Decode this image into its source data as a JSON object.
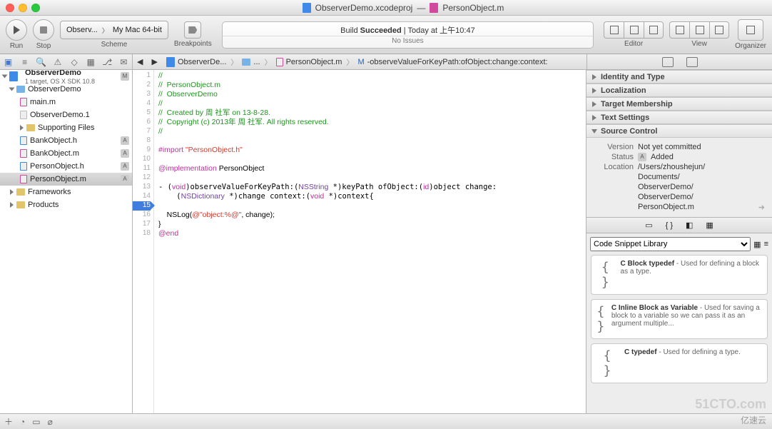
{
  "title": {
    "project": "ObserverDemo.xcodeproj",
    "sep": "—",
    "file": "PersonObject.m"
  },
  "toolbar": {
    "run": "Run",
    "stop": "Stop",
    "scheme": "Scheme",
    "breakpoints": "Breakpoints",
    "scheme_left": "Observ...",
    "scheme_right": "My Mac 64-bit",
    "editor": "Editor",
    "view": "View",
    "organizer": "Organizer"
  },
  "status": {
    "line1a": "Build ",
    "line1b": "Succeeded",
    "line1c": "  |  Today at 上午10:47",
    "line2": "No Issues"
  },
  "jumpbar": {
    "a": "ObserverDe...",
    "b": "...",
    "c": "PersonObject.m",
    "d": "-observeValueForKeyPath:ofObject:change:context:"
  },
  "tree": {
    "project": "ObserverDemo",
    "project_sub": "1 target, OS X SDK 10.8",
    "g1": "ObserverDemo",
    "items": [
      "main.m",
      "ObserverDemo.1",
      "Supporting Files",
      "BankObject.h",
      "BankObject.m",
      "PersonObject.h",
      "PersonObject.m"
    ],
    "g2": "Frameworks",
    "g3": "Products"
  },
  "code": {
    "l1": "//",
    "l2": "//  PersonObject.m",
    "l3": "//  ObserverDemo",
    "l4": "//",
    "l5": "//  Created by 周 社军 on 13-8-28.",
    "l6": "//  Copyright (c) 2013年 周 社军. All rights reserved.",
    "l7": "//",
    "l8": "",
    "l9a": "#import ",
    "l9b": "\"PersonObject.h\"",
    "l10": "",
    "l11a": "@implementation",
    "l11b": " PersonObject",
    "l12": "",
    "l13": "- (void)observeValueForKeyPath:(NSString *)keyPath ofObject:(id)object change:(NSDictionary *)change context:(void *)context{",
    "l14": "",
    "l15a": "    NSLog(",
    "l15b": "@\"object:%@\"",
    "l15c": ", change);",
    "l16": "}",
    "l17": "@end"
  },
  "inspector": {
    "identity": "Identity and Type",
    "localization": "Localization",
    "membership": "Target Membership",
    "textsettings": "Text Settings",
    "sourcecontrol": "Source Control",
    "sc": {
      "vk": "Version",
      "vv": "Not yet committed",
      "sk": "Status",
      "sv": "Added",
      "lk": "Location",
      "lv1": "/Users/zhoushejun/",
      "lv2": "Documents/",
      "lv3": "ObserverDemo/",
      "lv4": "ObserverDemo/",
      "lv5": "PersonObject.m"
    }
  },
  "library": {
    "title": "Code Snippet Library",
    "s1t": "C Block typedef",
    "s1d": " - Used for defining a block as a type.",
    "s2t": "C Inline Block as Variable",
    "s2d": " - Used for saving a block to a variable so we can pass it as an argument multiple...",
    "s3t": "C typedef",
    "s3d": " - Used for defining a type."
  },
  "watermark": "51CTO.com",
  "watermark2": "亿速云"
}
